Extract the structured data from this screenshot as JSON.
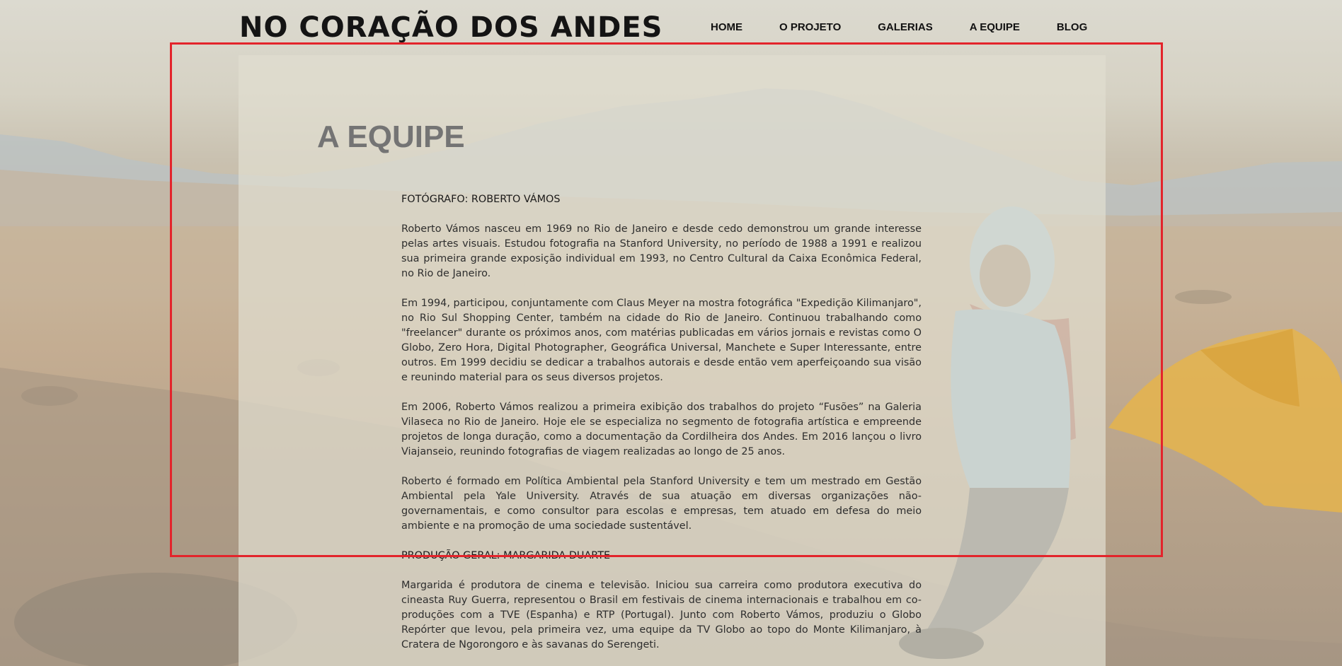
{
  "header": {
    "site_title": "NO CORAÇÃO DOS ANDES",
    "nav": [
      {
        "label": "HOME"
      },
      {
        "label": "O PROJETO"
      },
      {
        "label": "GALERIAS"
      },
      {
        "label": "A EQUIPE"
      },
      {
        "label": "BLOG"
      }
    ]
  },
  "main": {
    "section_title": "A EQUIPE",
    "members": [
      {
        "heading": "FOTÓGRAFO: ROBERTO VÁMOS",
        "paragraphs": [
          "Roberto Vámos nasceu em 1969 no Rio de Janeiro e desde cedo demonstrou um grande interesse pelas artes visuais.  Estudou fotografia na Stanford University, no período de 1988 a 1991 e realizou sua primeira grande exposição individual em 1993, no Centro Cultural da Caixa Econômica Federal, no Rio de Janeiro.",
          "Em 1994, participou, conjuntamente com Claus Meyer na mostra fotográfica \"Expedição Kilimanjaro\", no Rio Sul Shopping Center, também na cidade do Rio de Janeiro.  Continuou trabalhando como \"freelancer\" durante os próximos anos, com matérias publicadas em vários jornais e revistas como O Globo, Zero Hora, Digital Photographer, Geográfica Universal, Manchete e Super Interessante, entre outros.  Em 1999 decidiu se dedicar a trabalhos autorais e desde então vem aperfeiçoando sua visão e reunindo material para os seus diversos projetos.",
          "Em 2006, Roberto Vámos realizou a primeira exibição dos trabalhos do projeto “Fusões” na Galeria Vilaseca no Rio de Janeiro.  Hoje ele se especializa no segmento de fotografia artística e empreende projetos de longa duração, como a documentação da Cordilheira dos Andes. Em 2016 lançou o livro Viajanseio, reunindo fotografias de viagem realizadas ao longo de 25 anos.",
          "Roberto é formado em Política Ambiental pela Stanford University e tem um mestrado em Gestão Ambiental pela Yale University.  Através de sua atuação em diversas organizações não-governamentais, e como consultor para escolas e empresas, tem atuado em defesa do meio ambiente e na promoção de uma sociedade sustentável."
        ]
      },
      {
        "heading": "PRODUÇÃO GERAL: MARGARIDA DUARTE",
        "paragraphs": [
          "Margarida é produtora de cinema e televisão.  Iniciou sua carreira como produtora executiva do cineasta Ruy Guerra, representou o Brasil em festivais de cinema internacionais e trabalhou em co-produções com a TVE (Espanha) e RTP (Portugal).  Junto com Roberto Vámos, produziu o Globo Repórter que levou, pela primeira vez, uma equipe da TV Globo ao topo do Monte Kilimanjaro, à Cratera de Ngorongoro e às savanas do Serengeti."
        ]
      }
    ]
  },
  "colors": {
    "highlight_border": "#e3242b",
    "section_title": "#747474",
    "body_text": "#2e2e2e",
    "site_title": "#141414"
  }
}
